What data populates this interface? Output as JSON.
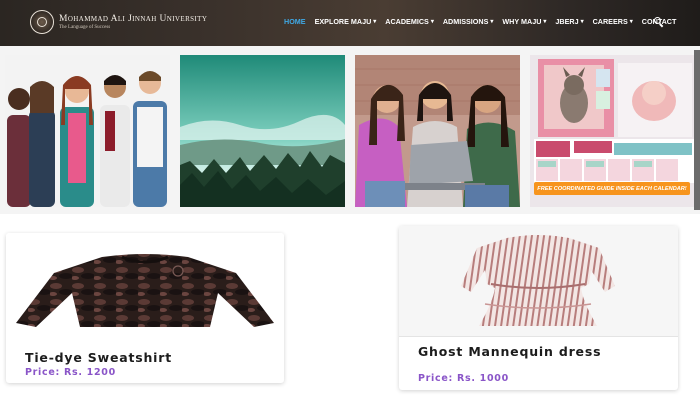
{
  "header": {
    "logo_name": "Mohammad Ali Jinnah University",
    "logo_tagline": "The Language of Success",
    "nav": [
      {
        "label": "HOME",
        "active": true,
        "dropdown": false
      },
      {
        "label": "EXPLORE MAJU",
        "active": false,
        "dropdown": true
      },
      {
        "label": "ACADEMICS",
        "active": false,
        "dropdown": true
      },
      {
        "label": "ADMISSIONS",
        "active": false,
        "dropdown": true
      },
      {
        "label": "WHY MAJU",
        "active": false,
        "dropdown": true
      },
      {
        "label": "JBERJ",
        "active": false,
        "dropdown": true
      },
      {
        "label": "CAREERS",
        "active": false,
        "dropdown": true
      },
      {
        "label": "CONTACT",
        "active": false,
        "dropdown": false
      }
    ],
    "search_icon": "search-icon",
    "active_color": "#3fa9e6"
  },
  "gallery": {
    "banner_text": "FREE COORDINATED GUIDE INSIDE EACH CALENDAR!",
    "banner_color": "#f7941d"
  },
  "products": [
    {
      "title": "Tie-dye Sweatshirt",
      "price": "Price: Rs. 1200"
    },
    {
      "title": "Ghost Mannequin dress",
      "price": "Price: Rs. 1000"
    }
  ],
  "colors": {
    "price": "#8a55c8"
  }
}
